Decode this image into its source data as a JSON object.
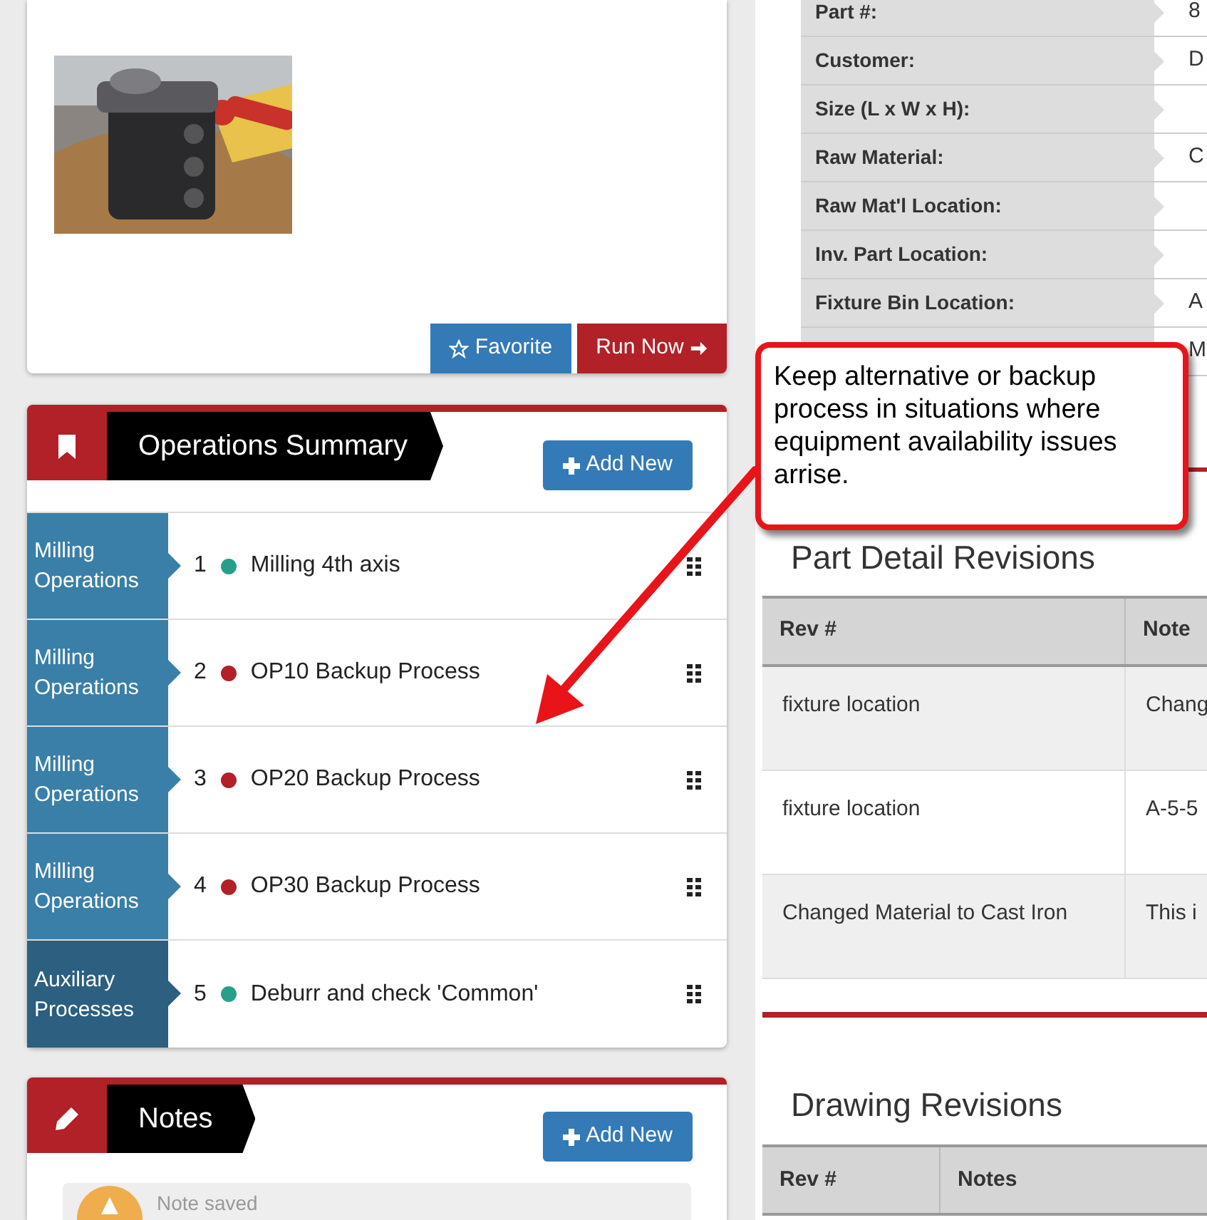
{
  "product_card": {
    "buttons": [
      {
        "label": "Favorite",
        "kind": "favorite"
      },
      {
        "label": "Run Now",
        "kind": "run"
      }
    ]
  },
  "operations_summary": {
    "title": "Operations Summary",
    "add_button": "Add New",
    "operations": [
      {
        "category": "Milling Operations",
        "kind": "milling",
        "number": "1",
        "name": "Milling 4th axis",
        "color": "#26a08a"
      },
      {
        "category": "Milling Operations",
        "kind": "milling",
        "number": "2",
        "name": "OP10 Backup Process",
        "color": "#b22028"
      },
      {
        "category": "Milling Operations",
        "kind": "milling",
        "number": "3",
        "name": "OP20 Backup Process",
        "color": "#b22028"
      },
      {
        "category": "Milling Operations",
        "kind": "milling",
        "number": "4",
        "name": "OP30 Backup Process",
        "color": "#b22028"
      },
      {
        "category": "Auxiliary Processes",
        "kind": "auxiliary",
        "number": "5",
        "name": "Deburr and check 'Common'",
        "color": "#26a08a"
      }
    ]
  },
  "notes": {
    "title": "Notes",
    "add_button": "Add New",
    "alert": "Note saved"
  },
  "part_details": {
    "rows": [
      {
        "label": "Part #:",
        "value": "8"
      },
      {
        "label": "Customer:",
        "value": "D"
      },
      {
        "label": "Size (L x W x H):"
      },
      {
        "label": "Raw Material:",
        "value": "C"
      },
      {
        "label": "Raw Mat'l Location:"
      },
      {
        "label": "Inv. Part Location:"
      },
      {
        "label": "Fixture Bin Location:",
        "value": "A"
      },
      {
        "value": "M"
      }
    ]
  },
  "callout": {
    "text": "Keep alternative or backup process in situations where equipment availability issues arrise."
  },
  "part_detail_revisions": {
    "title": "Part Detail Revisions",
    "columns": [
      "Rev #",
      "Note"
    ],
    "rows": [
      [
        "fixture location",
        "Chang"
      ],
      [
        "fixture location",
        "A-5-5"
      ],
      [
        "Changed Material to Cast Iron",
        "This i"
      ]
    ]
  },
  "drawing_revisions": {
    "title": "Drawing Revisions",
    "columns": [
      "Rev #",
      "Notes"
    ]
  }
}
